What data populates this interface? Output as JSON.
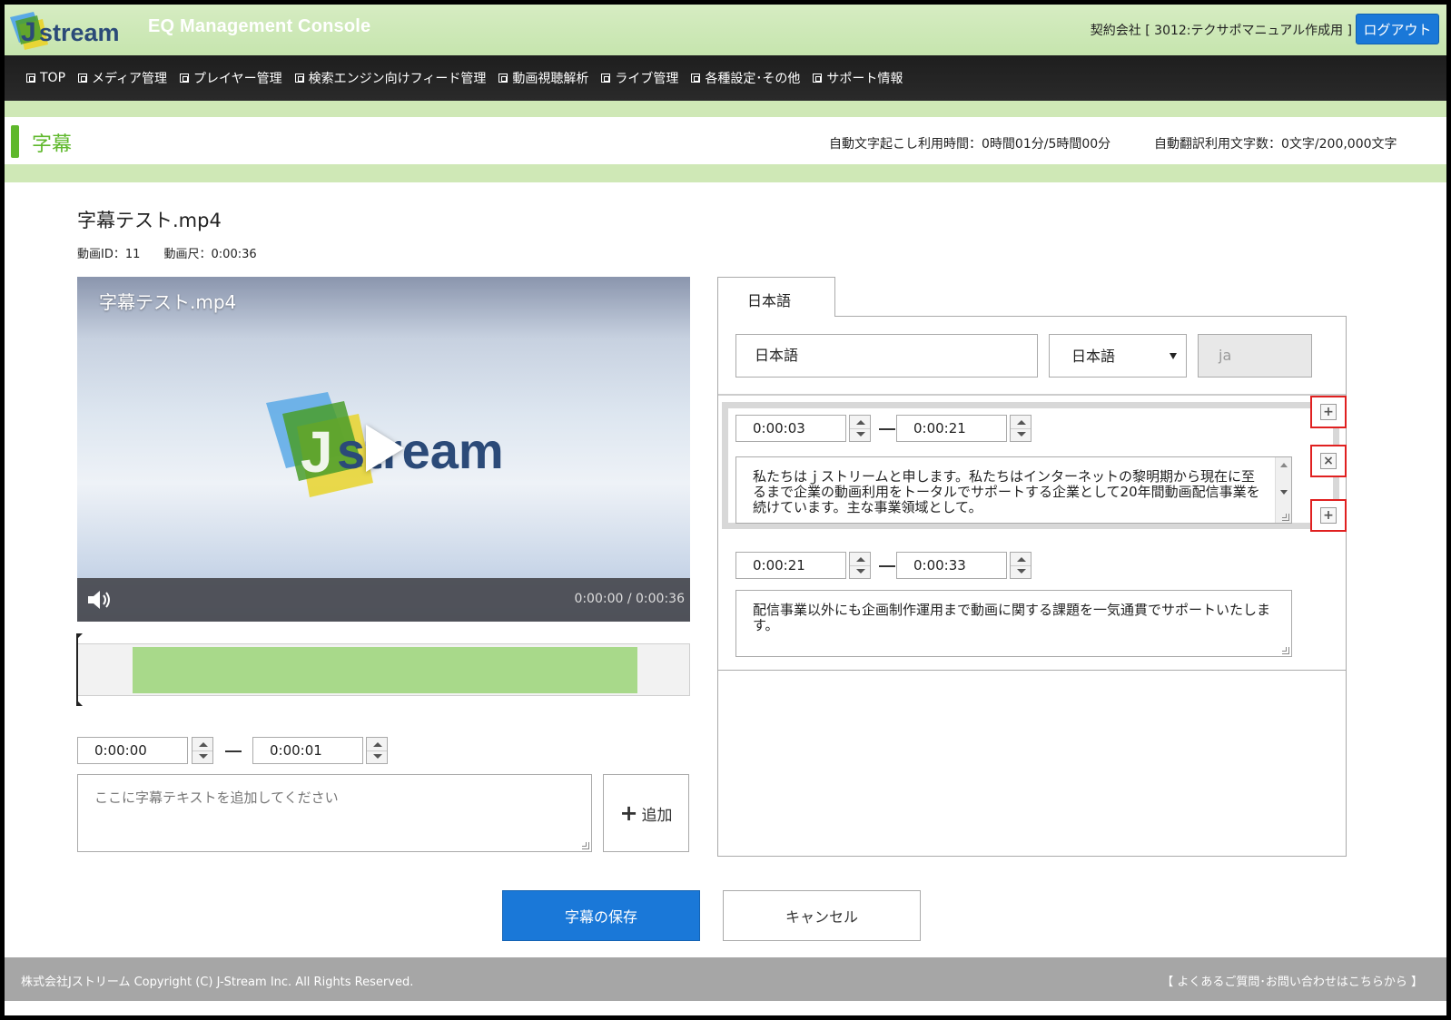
{
  "header": {
    "logo_text": "Jstream",
    "console_title": "EQ Management Console",
    "contract": "契約会社 [ 3012:テクサポマニュアル作成用 ]",
    "logout_label": "ログアウト"
  },
  "nav": {
    "items": [
      {
        "label": "TOP"
      },
      {
        "label": "メディア管理"
      },
      {
        "label": "プレイヤー管理"
      },
      {
        "label": "検索エンジン向けフィード管理"
      },
      {
        "label": "動画視聴解析"
      },
      {
        "label": "ライブ管理"
      },
      {
        "label": "各種設定･その他"
      },
      {
        "label": "サポート情報"
      }
    ]
  },
  "page": {
    "title": "字幕",
    "usage_transcription": "自動文字起こし利用時間：0時間01分/5時間00分",
    "usage_translation": "自動翻訳利用文字数：0文字/200,000文字"
  },
  "file": {
    "name": "字幕テスト.mp4",
    "video_id": "動画ID：11",
    "duration": "動画尺：0:00:36"
  },
  "player": {
    "title": "字幕テスト.mp4",
    "logo_text": "Jstream",
    "time": "0:00:00 / 0:00:36",
    "volume_icon": "speaker-icon",
    "play_icon": "play-icon"
  },
  "timeline": {
    "selection_start_fraction": 0.0,
    "selection_end_fraction": 0.028
  },
  "new_cue": {
    "start": "0:00:00",
    "end": "0:00:01",
    "placeholder": "ここに字幕テキストを追加してください",
    "add_label": "追加"
  },
  "subtitle_panel": {
    "tab_label": "日本語",
    "language_name": "日本語",
    "language_select": "日本語",
    "language_code": "ja",
    "cues": [
      {
        "start": "0:00:03",
        "end": "0:00:21",
        "text": "私たちはｊストリームと申します。私たちはインターネットの黎明期から現在に至るまで企業の動画利用をトータルでサポートする企業として20年間動画配信事業を続けています。主な事業領域として。"
      },
      {
        "start": "0:00:21",
        "end": "0:00:33",
        "text": "配信事業以外にも企画制作運用まで動画に関する課題を一気通貫でサポートいたします。"
      }
    ]
  },
  "actions": {
    "save_label": "字幕の保存",
    "cancel_label": "キャンセル"
  },
  "footer": {
    "copyright": "株式会社Jストリーム Copyright (C) J-Stream Inc. All Rights Reserved.",
    "faq_link": "【 よくあるご質問･お問い合わせはこちらから 】"
  },
  "colors": {
    "brand_green": "#5fb82c",
    "header_green": "#cfe8b6",
    "primary_blue": "#1a78d8",
    "timeline_selection": "#a8d98a",
    "highlight_red": "#e02020"
  }
}
